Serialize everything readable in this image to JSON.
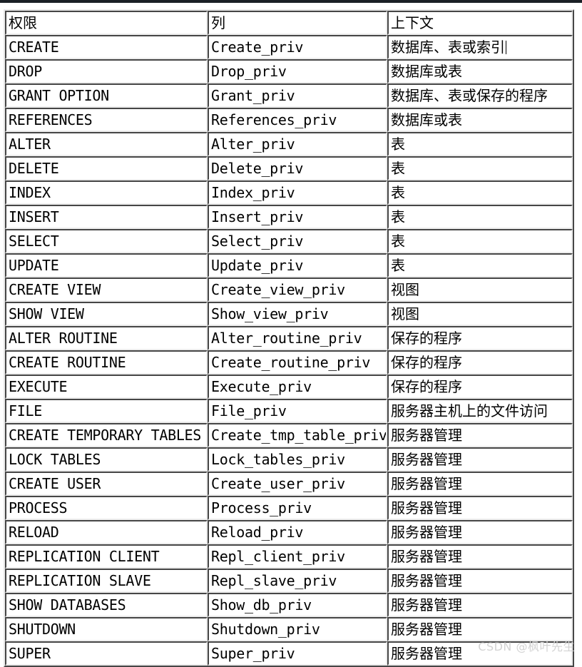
{
  "page": {
    "background_color": "#ffffff",
    "top_strip_color": "#1b2026",
    "text_color": "#000000",
    "border_color": "#9a9a9a"
  },
  "table": {
    "headers": [
      "权限",
      "列",
      "上下文"
    ],
    "rows": [
      {
        "privilege": "CREATE",
        "column": "Create_priv",
        "context": "数据库、表或索引"
      },
      {
        "privilege": "DROP",
        "column": "Drop_priv",
        "context": "数据库或表"
      },
      {
        "privilege": "GRANT OPTION",
        "column": "Grant_priv",
        "context": "数据库、表或保存的程序"
      },
      {
        "privilege": "REFERENCES",
        "column": "References_priv",
        "context": "数据库或表"
      },
      {
        "privilege": "ALTER",
        "column": "Alter_priv",
        "context": "表"
      },
      {
        "privilege": "DELETE",
        "column": "Delete_priv",
        "context": "表"
      },
      {
        "privilege": "INDEX",
        "column": "Index_priv",
        "context": "表"
      },
      {
        "privilege": "INSERT",
        "column": "Insert_priv",
        "context": "表"
      },
      {
        "privilege": "SELECT",
        "column": "Select_priv",
        "context": "表"
      },
      {
        "privilege": "UPDATE",
        "column": "Update_priv",
        "context": "表"
      },
      {
        "privilege": "CREATE VIEW",
        "column": "Create_view_priv",
        "context": "视图"
      },
      {
        "privilege": "SHOW VIEW",
        "column": "Show_view_priv",
        "context": "视图"
      },
      {
        "privilege": "ALTER ROUTINE",
        "column": "Alter_routine_priv",
        "context": "保存的程序"
      },
      {
        "privilege": "CREATE ROUTINE",
        "column": "Create_routine_priv",
        "context": "保存的程序"
      },
      {
        "privilege": "EXECUTE",
        "column": "Execute_priv",
        "context": "保存的程序"
      },
      {
        "privilege": "FILE",
        "column": "File_priv",
        "context": "服务器主机上的文件访问"
      },
      {
        "privilege": "CREATE TEMPORARY TABLES",
        "column": "Create_tmp_table_priv",
        "context": "服务器管理"
      },
      {
        "privilege": "LOCK TABLES",
        "column": "Lock_tables_priv",
        "context": "服务器管理"
      },
      {
        "privilege": "CREATE USER",
        "column": "Create_user_priv",
        "context": "服务器管理"
      },
      {
        "privilege": "PROCESS",
        "column": "Process_priv",
        "context": "服务器管理"
      },
      {
        "privilege": "RELOAD",
        "column": "Reload_priv",
        "context": "服务器管理"
      },
      {
        "privilege": "REPLICATION CLIENT",
        "column": "Repl_client_priv",
        "context": "服务器管理"
      },
      {
        "privilege": "REPLICATION SLAVE",
        "column": "Repl_slave_priv",
        "context": "服务器管理"
      },
      {
        "privilege": "SHOW DATABASES",
        "column": "Show_db_priv",
        "context": "服务器管理"
      },
      {
        "privilege": "SHUTDOWN",
        "column": "Shutdown_priv",
        "context": "服务器管理"
      },
      {
        "privilege": "SUPER",
        "column": "Super_priv",
        "context": "服务器管理"
      }
    ]
  },
  "watermark": {
    "text": "CSDN @枫叶先生",
    "color": "#d3d3d3"
  }
}
